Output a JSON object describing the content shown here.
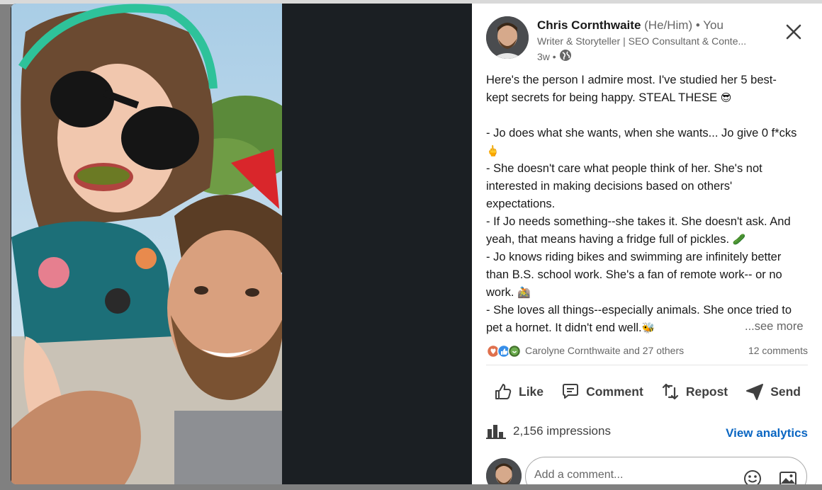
{
  "post": {
    "author_name": "Chris Cornthwaite",
    "pronouns": "(He/Him)",
    "you_label": "• You",
    "headline": "Writer & Storyteller | SEO Consultant & Conte...",
    "time_ago": "3w •",
    "visibility_icon": "globe-icon",
    "body": [
      "Here's the person I admire most. I've studied her 5 best-kept secrets for being happy. STEAL THESE",
      "",
      "- Jo does what she wants, when she wants... Jo give 0 f*cks",
      "- She doesn't care what people think of her. She's not interested in making decisions based on others' expectations.",
      "- If Jo needs something--she takes it. She doesn't ask. And yeah, that means having a fridge full of pickles.",
      "- Jo knows riding bikes and swimming are infinitely better than B.S. school work. She's a fan of remote work-- or no work.",
      "- She loves all things--especially animals. She once tried to pet a hornet. It didn't end well."
    ],
    "body_emojis": [
      "😎",
      "🖕",
      "🥒",
      "🚵",
      "🐝"
    ],
    "see_more": "...see more"
  },
  "social": {
    "reaction_names": "Carolyne Cornthwaite and 27 others",
    "comments_count": "12 comments",
    "reaction_icons": [
      "love-icon",
      "like-icon",
      "celebrate-icon"
    ]
  },
  "actions": {
    "like": "Like",
    "comment": "Comment",
    "repost": "Repost",
    "send": "Send"
  },
  "analytics": {
    "impressions": "2,156 impressions",
    "view_analytics": "View analytics"
  },
  "comment_box": {
    "placeholder": "Add a comment..."
  },
  "colors": {
    "accent": "#0a66c2",
    "text": "#191919",
    "muted": "#666666",
    "modal_bg": "#1b1f23"
  }
}
